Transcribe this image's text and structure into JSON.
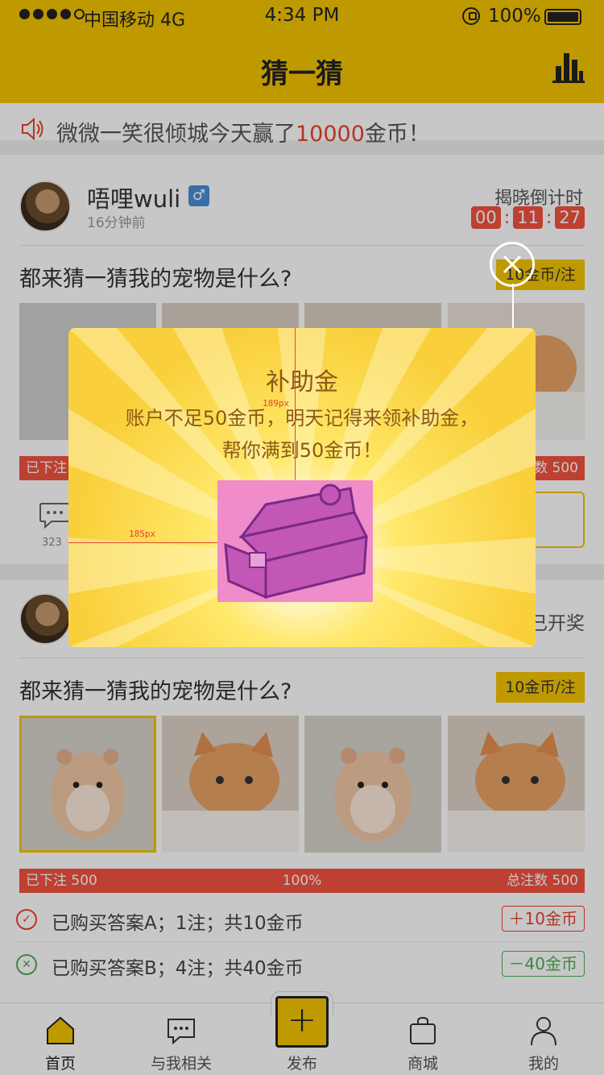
{
  "status_bar": {
    "carrier": "中国移动",
    "network": "4G",
    "time": "4:34 PM",
    "battery": "100%"
  },
  "nav": {
    "title": "猜一猜",
    "right_icon": "bar-chart-icon"
  },
  "notice": {
    "prefix": "微微一笑很倾城今天赢了",
    "amount": "10000",
    "suffix": "金币！",
    "icon": "speaker-icon",
    "highlight_color": "#e8442f"
  },
  "post1": {
    "username": "唔哩wuli",
    "gender": "♂",
    "time": "16分钟前",
    "countdown_label": "揭晓倒计时",
    "countdown": [
      "00",
      "11",
      "27"
    ],
    "question": "都来猜一猜我的宠物是什么?",
    "price": "10金币/注",
    "bet_left": "已下注",
    "bet_right": "数 500",
    "comment_count": "323"
  },
  "post2": {
    "status": "已开奖",
    "question": "都来猜一猜我的宠物是什么?",
    "price": "10金币/注",
    "bet_left": "已下注 500",
    "bet_center": "100%",
    "bet_right": "总注数 500",
    "records": [
      {
        "text": "已购买答案A；1注；共10金币",
        "amount": "＋10金币",
        "result": "win"
      },
      {
        "text": "已购买答案B；4注；共40金币",
        "amount": "－40金币",
        "result": "lose"
      }
    ]
  },
  "tabs": [
    {
      "label": "首页",
      "icon": "home-icon",
      "active": true
    },
    {
      "label": "与我相关",
      "icon": "chat-icon",
      "active": false
    },
    {
      "label": "发布",
      "icon": "plus-icon",
      "active": false
    },
    {
      "label": "商城",
      "icon": "bag-icon",
      "active": false
    },
    {
      "label": "我的",
      "icon": "person-icon",
      "active": false
    }
  ],
  "popup": {
    "title": "补助金",
    "message": "账户不足50金币，明天记得来领补助金，帮你满到50金币！",
    "image": "treasure-chest-icon",
    "guide_vertical": "189px",
    "guide_horizontal": "185px",
    "close_icon": "close-icon"
  },
  "colors": {
    "brand": "#f5c400",
    "accent_red": "#f25241",
    "positive_green": "#4caf50"
  }
}
